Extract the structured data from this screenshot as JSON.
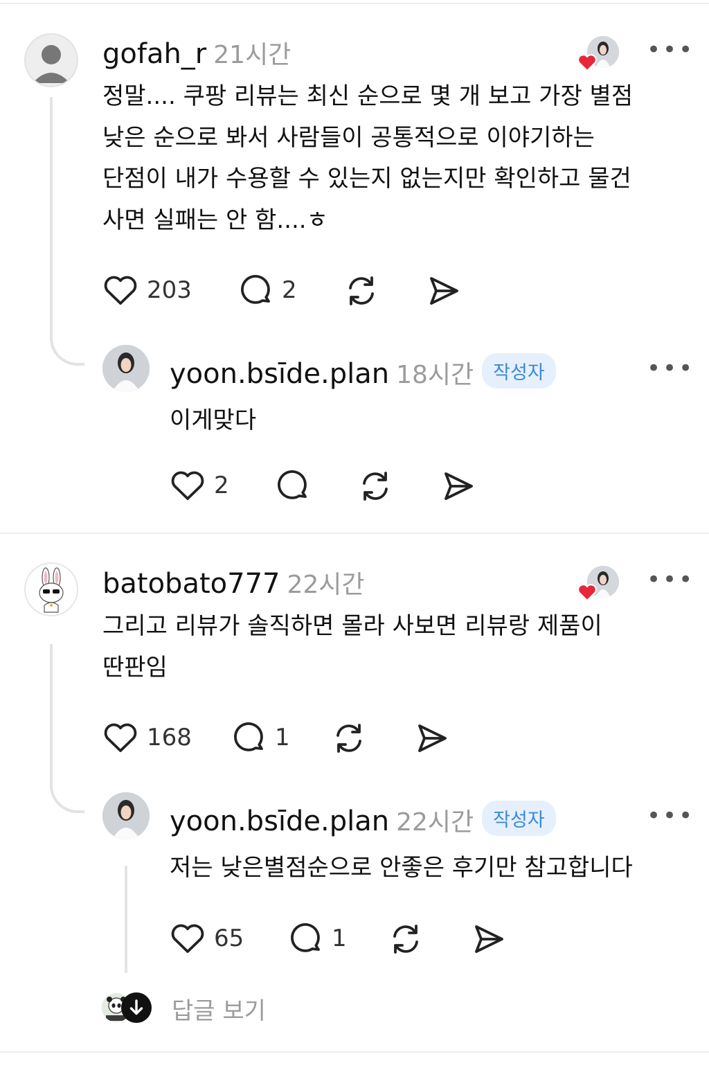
{
  "comments": [
    {
      "username": "gofah_r",
      "time": "21시간",
      "text": "정말.... 쿠팡 리뷰는 최신 순으로 몇 개 보고 가장 별점\n낮은 순으로 봐서 사람들이 공통적으로 이야기하는\n단점이 내가 수용할 수 있는지 없는지만 확인하고 물건\n사면 실패는 안 함....ㅎ",
      "likes": "203",
      "replies": "2",
      "reply": {
        "username": "yoon.bsīde.plan",
        "time": "18시간",
        "badge": "작성자",
        "text": "이게맞다",
        "likes": "2",
        "replies": ""
      }
    },
    {
      "username": "batobato777",
      "time": "22시간",
      "text": "그리고 리뷰가 솔직하면 몰라 사보면 리뷰랑 제품이\n딴판임",
      "likes": "168",
      "replies": "1",
      "reply": {
        "username": "yoon.bsīde.plan",
        "time": "22시간",
        "badge": "작성자",
        "text": "저는 낮은별점순으로 안좋은 후기만 참고합니다",
        "likes": "65",
        "replies": "1"
      }
    }
  ],
  "more_label": "•••",
  "view_replies_label": "답글 보기",
  "icons": [
    "heart-icon",
    "comment-icon",
    "repost-icon",
    "share-icon",
    "more-icon",
    "liked-heart-icon",
    "chevron-down-icon"
  ],
  "colors": {
    "badge_bg": "#e5f0fc",
    "badge_text": "#3d8ad6",
    "liked_heart": "#e8263a",
    "muted": "#9b9b9b"
  }
}
